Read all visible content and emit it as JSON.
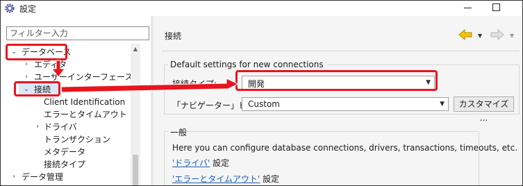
{
  "window": {
    "title": "設定"
  },
  "filter": {
    "placeholder": "フィルター入力"
  },
  "tree": [
    {
      "label": "データベース",
      "twisty": "expanded"
    },
    {
      "label": "エディタ",
      "twisty": "collapsed"
    },
    {
      "label": "ユーザーインターフェース",
      "twisty": "collapsed"
    },
    {
      "label": "接続",
      "twisty": "expanded"
    },
    {
      "label": "Client Identification",
      "twisty": "none"
    },
    {
      "label": "エラーとタイムアウト",
      "twisty": "none"
    },
    {
      "label": "ドライバ",
      "twisty": "collapsed"
    },
    {
      "label": "トランザクション",
      "twisty": "none"
    },
    {
      "label": "メタデータ",
      "twisty": "none"
    },
    {
      "label": "接続タイプ",
      "twisty": "none"
    },
    {
      "label": "データ管理",
      "twisty": "collapsed"
    }
  ],
  "page": {
    "title": "接続",
    "group_title": "Default settings for new connections",
    "conn_type_label": "接続タイプ:",
    "conn_type_value": "開発",
    "navigator_label": "「ナビゲーター」ビュー:",
    "navigator_value": "Custom",
    "customize_button": "カスタマイズ ...",
    "general_title": "一般",
    "general_desc": "Here you can configure database connections, drivers, transactions, timeouts, etc.",
    "link1": "'ドライバ'",
    "link1_suffix": " 設定",
    "link2": "'エラーとタイムアウト'",
    "link2_suffix": " 設定"
  },
  "colors": {
    "highlight": "#e8141e",
    "link": "#1a5fb4",
    "back_arrow": "#f5c400"
  },
  "icons": {
    "app": "gear-icon",
    "back": "back-arrow-icon",
    "forward": "forward-arrow-icon"
  }
}
